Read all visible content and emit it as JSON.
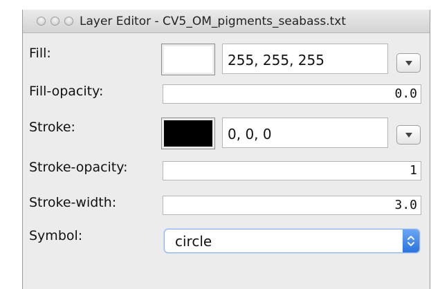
{
  "window": {
    "title": "Layer Editor - CV5_OM_pigments_seabass.txt"
  },
  "fill": {
    "label": "Fill:",
    "swatch_color": "#ffffff",
    "value": "255, 255, 255"
  },
  "fill_opacity": {
    "label": "Fill-opacity:",
    "value": "0.0"
  },
  "stroke": {
    "label": "Stroke:",
    "swatch_color": "#000000",
    "value": "0, 0, 0"
  },
  "stroke_opacity": {
    "label": "Stroke-opacity:",
    "value": "1"
  },
  "stroke_width": {
    "label": "Stroke-width:",
    "value": "3.0"
  },
  "symbol": {
    "label": "Symbol:",
    "value": "circle"
  },
  "icons": {
    "window_buttons": [
      "close-icon",
      "minimize-icon",
      "zoom-icon"
    ],
    "dropdown": "chevron-down-icon",
    "select_stepper": "up-down-chevron-icon"
  },
  "colors": {
    "select_accent": "#2a72de"
  }
}
